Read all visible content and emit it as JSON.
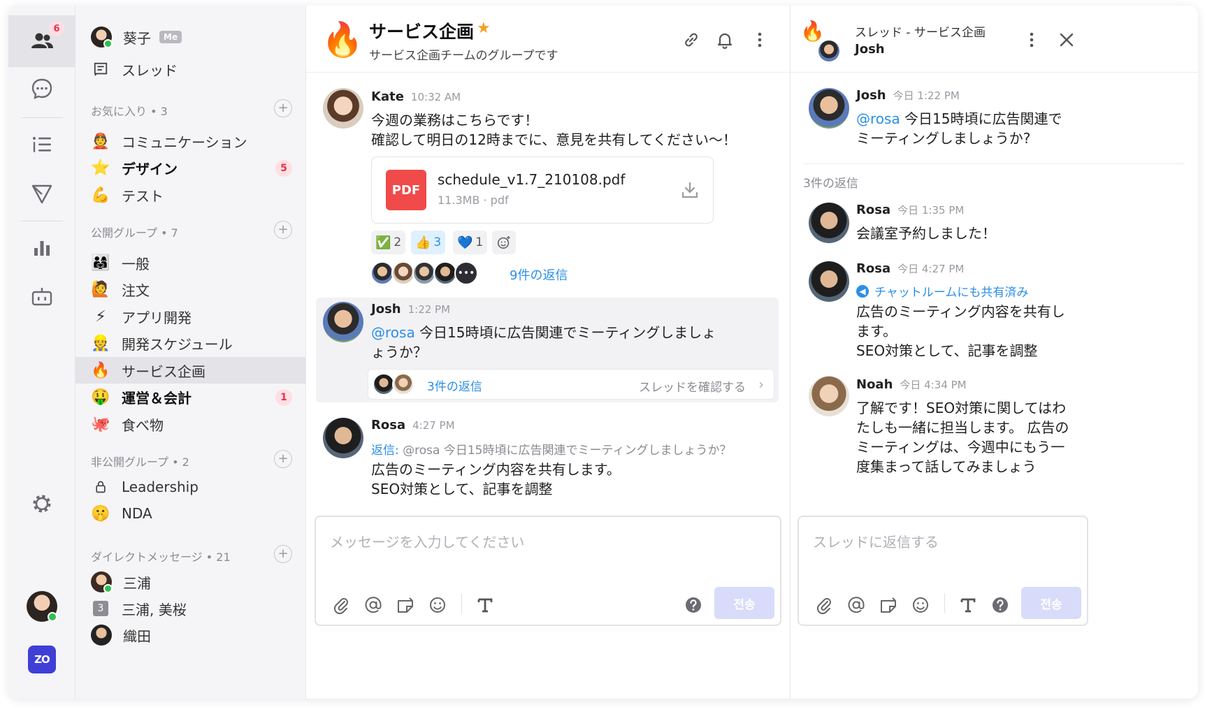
{
  "rail": {
    "badge": "6",
    "icons": [
      "people-icon",
      "chat-bubble-icon",
      "list-icon",
      "send-icon",
      "bar-chart-icon",
      "bot-icon",
      "settings-icon"
    ],
    "logo": "ZO"
  },
  "sidebar": {
    "me": {
      "name": "葵子",
      "tag": "Me"
    },
    "threads_label": "スレッド",
    "favorites": {
      "title": "お気に入り • 3",
      "items": [
        {
          "emoji": "👲",
          "label": "コミュニケーション",
          "bold": false,
          "badge": ""
        },
        {
          "emoji": "⭐",
          "label": "デザイン",
          "bold": true,
          "badge": "5"
        },
        {
          "emoji": "💪",
          "label": "テスト",
          "bold": false,
          "badge": ""
        }
      ]
    },
    "public": {
      "title": "公開グループ • 7",
      "items": [
        {
          "emoji": "👨‍👩‍👧",
          "label": "一般",
          "bold": false,
          "badge": ""
        },
        {
          "emoji": "🙋",
          "label": "注文",
          "bold": false,
          "badge": ""
        },
        {
          "emoji": "⚡",
          "label": "アプリ開発",
          "bold": false,
          "badge": ""
        },
        {
          "emoji": "👷",
          "label": "開発スケジュール",
          "bold": false,
          "badge": ""
        },
        {
          "emoji": "🔥",
          "label": "サービス企画",
          "bold": false,
          "badge": "",
          "active": true
        },
        {
          "emoji": "🤑",
          "label": "運営＆会計",
          "bold": true,
          "badge": "1"
        },
        {
          "emoji": "🐙",
          "label": "食べ物",
          "bold": false,
          "badge": ""
        }
      ]
    },
    "private": {
      "title": "非公開グループ • 2",
      "items": [
        {
          "emoji": "🔒",
          "label": "Leadership"
        },
        {
          "emoji": "🤫",
          "label": "NDA"
        }
      ]
    },
    "dm": {
      "title": "ダイレクトメッセージ • 21",
      "items": [
        {
          "label": "三浦"
        },
        {
          "num": "3",
          "label": "三浦, 美桜"
        },
        {
          "label": "織田"
        }
      ]
    }
  },
  "channel": {
    "emoji": "🔥",
    "title": "サービス企画",
    "star": "★",
    "subtitle": "サービス企画チームのグループです"
  },
  "messages": {
    "kate": {
      "name": "Kate",
      "time": "10:32 AM",
      "line1": "今週の業務はこちらです！",
      "line2": "確認して明日の12時までに、意見を共有してください〜！",
      "file": {
        "badge": "PDF",
        "name": "schedule_v1.7_210108.pdf",
        "meta": "11.3MB · pdf"
      },
      "reactions": [
        {
          "emoji": "✅",
          "count": "2"
        },
        {
          "emoji": "👍",
          "count": "3"
        },
        {
          "emoji": "💙",
          "count": "1"
        }
      ],
      "replies": "9件の返信"
    },
    "josh": {
      "name": "Josh",
      "time": "1:22 PM",
      "mention": "@rosa",
      "text1": " 今日15時頃に広告関連でミーティングしましょ",
      "text2": "ょうか？",
      "replies": "3件の返信",
      "check": "スレッドを確認する"
    },
    "rosa": {
      "name": "Rosa",
      "time": "4:27 PM",
      "reply_label": "返信:",
      "quote": " @rosa 今日15時頃に広告関連でミーティングしましょうか？",
      "line1": "広告のミーティング内容を共有します。",
      "line2": "SEO対策として、記事を調整"
    }
  },
  "composer": {
    "placeholder": "メッセージを入力してください",
    "send": "전송",
    "tools": [
      "paperclip-icon",
      "at-icon",
      "sticker-icon",
      "emoji-icon",
      "text-format-icon",
      "help-icon"
    ]
  },
  "thread": {
    "title": "スレッド - サービス企画",
    "name": "Josh",
    "root": {
      "name": "Josh",
      "time": "今日 1:22 PM",
      "mention": "@rosa",
      "text1": " 今日15時頃に広告関連で",
      "text2": "ミーティングしましょうか?"
    },
    "reply_count": "3件の返信",
    "replies": [
      {
        "name": "Rosa",
        "time": "今日 1:35 PM",
        "lines": [
          "会議室予約しました！"
        ]
      },
      {
        "name": "Rosa",
        "time": "今日 4:27 PM",
        "shared": "チャットルームにも共有済み",
        "lines": [
          "広告のミーティング内容を共有し",
          "ます。",
          "SEO対策として、記事を調整"
        ]
      },
      {
        "name": "Noah",
        "time": "今日 4:34 PM",
        "lines": [
          "了解です！SEO対策に関してはわ",
          "たしも一緒に担当します。 広告の",
          "ミーティングは、今週中にもう一",
          "度集まって話してみましょう"
        ]
      }
    ],
    "placeholder": "スレッドに返信する",
    "send": "전송"
  }
}
